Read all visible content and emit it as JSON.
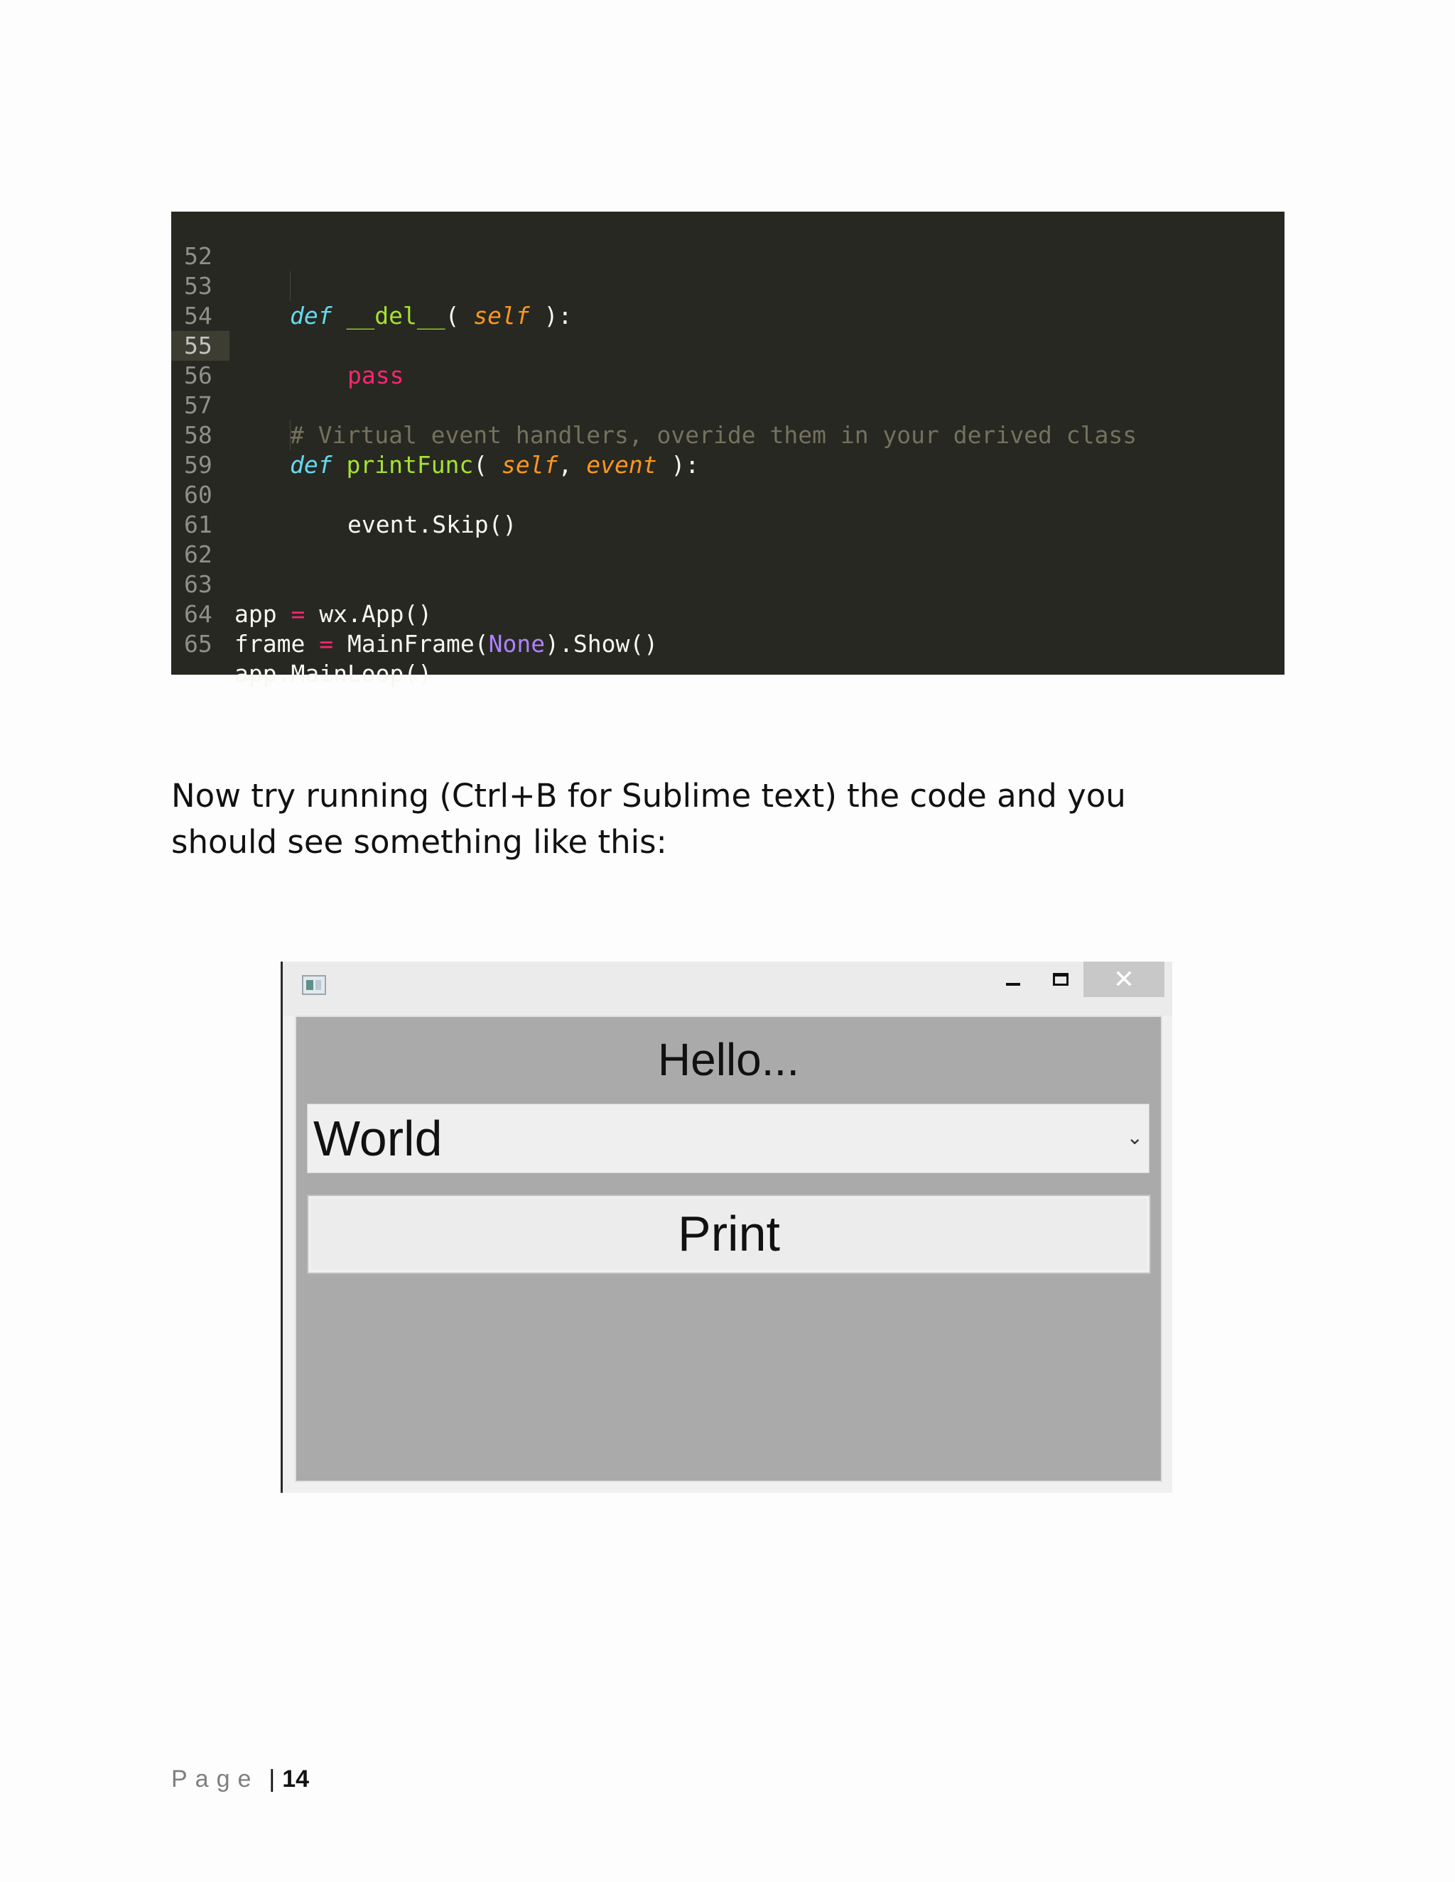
{
  "code": {
    "lines": [
      {
        "n": "52"
      },
      {
        "n": "53"
      },
      {
        "n": "54",
        "pass": "pass"
      },
      {
        "n": "55"
      },
      {
        "n": "56"
      },
      {
        "n": "57",
        "comment": "# Virtual event handlers, overide them in your derived class"
      },
      {
        "n": "58"
      },
      {
        "n": "59",
        "text": "event.Skip()"
      },
      {
        "n": "60"
      },
      {
        "n": "61"
      },
      {
        "n": "62"
      },
      {
        "n": "63"
      },
      {
        "n": "64"
      },
      {
        "n": "65",
        "text": "app.MainLoop()"
      }
    ],
    "tokens": {
      "def": "def",
      "del_name": "__del__",
      "del_open": "( ",
      "self": "self",
      "close_colon": " ):",
      "printfunc_name": "printFunc",
      "pf_open": "( ",
      "comma": ", ",
      "event": "event",
      "app_var": "app ",
      "eq": "=",
      "app_rhs": " wx.App()",
      "frame_var": "frame ",
      "frame_rhs_a": " MainFrame(",
      "none": "None",
      "frame_rhs_b": ").Show()"
    }
  },
  "prose": {
    "line1": "Now try running (Ctrl+B for Sublime text) the code and you",
    "line2": "should see something like this:"
  },
  "window": {
    "icon": "app-window-icon",
    "controls": {
      "minimize": "minimize-icon",
      "maximize": "maximize-icon",
      "close": "✕"
    },
    "hello_label": "Hello...",
    "choice_value": "World",
    "choice_chevron": "⌄",
    "print_label": "Print"
  },
  "footer": {
    "page_label": "Page",
    "separator": "|",
    "page_number": "14"
  }
}
